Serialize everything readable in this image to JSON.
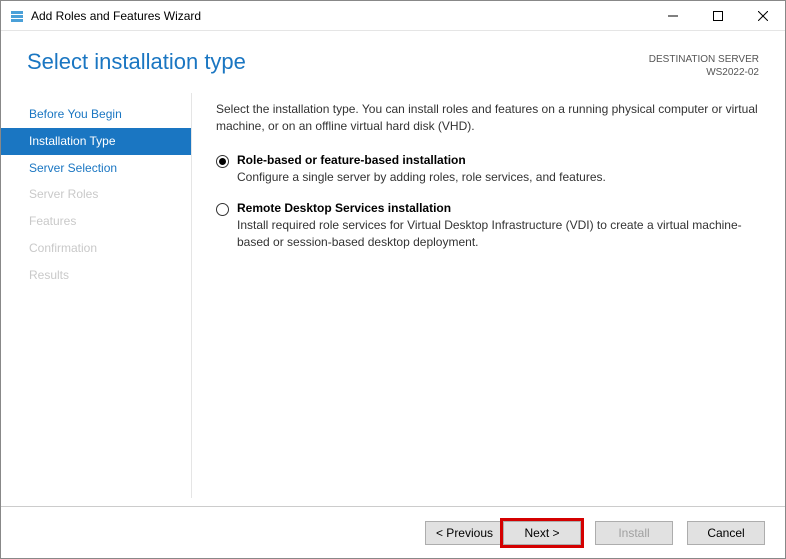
{
  "window": {
    "title": "Add Roles and Features Wizard"
  },
  "page": {
    "title": "Select installation type",
    "destination_label": "DESTINATION SERVER",
    "destination_value": "WS2022-02"
  },
  "sidebar": {
    "items": [
      {
        "label": "Before You Begin",
        "state": "normal"
      },
      {
        "label": "Installation Type",
        "state": "selected"
      },
      {
        "label": "Server Selection",
        "state": "normal"
      },
      {
        "label": "Server Roles",
        "state": "disabled"
      },
      {
        "label": "Features",
        "state": "disabled"
      },
      {
        "label": "Confirmation",
        "state": "disabled"
      },
      {
        "label": "Results",
        "state": "disabled"
      }
    ]
  },
  "main": {
    "intro": "Select the installation type. You can install roles and features on a running physical computer or virtual machine, or on an offline virtual hard disk (VHD).",
    "options": [
      {
        "title": "Role-based or feature-based installation",
        "desc": "Configure a single server by adding roles, role services, and features.",
        "checked": true
      },
      {
        "title": "Remote Desktop Services installation",
        "desc": "Install required role services for Virtual Desktop Infrastructure (VDI) to create a virtual machine-based or session-based desktop deployment.",
        "checked": false
      }
    ]
  },
  "footer": {
    "previous": "< Previous",
    "next": "Next >",
    "install": "Install",
    "cancel": "Cancel"
  }
}
